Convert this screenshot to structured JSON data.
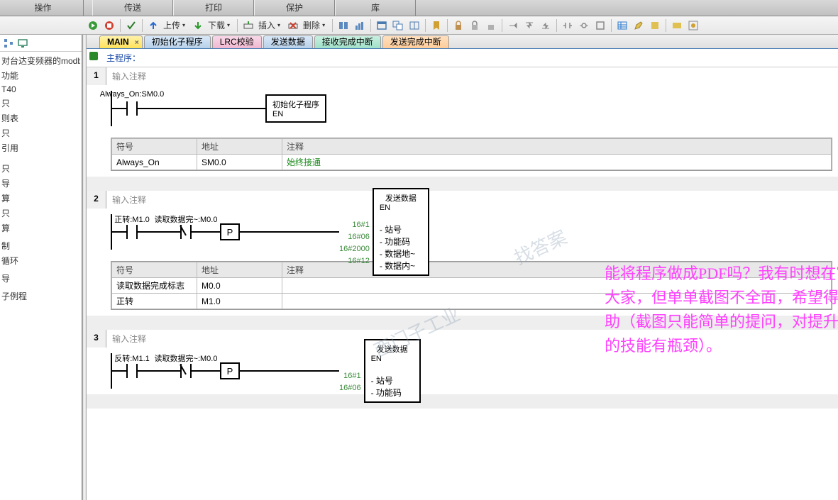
{
  "menu": {
    "items": [
      "操作",
      "传送",
      "打印",
      "保护",
      "库"
    ]
  },
  "toolbar": {
    "upload": "上传",
    "download": "下载",
    "insert": "插入",
    "delete": "删除"
  },
  "sidebar": {
    "items": [
      "对台达变频器的modbu",
      "功能",
      "T40",
      "只",
      "则表",
      "只",
      "引用",
      "",
      "",
      "只",
      "导",
      "算",
      "只",
      "算",
      "",
      "制",
      "循环",
      "",
      "导",
      "",
      "子例程"
    ]
  },
  "tabs": [
    {
      "label": "MAIN",
      "cls": "main close-x"
    },
    {
      "label": "初始化子程序",
      "cls": "blue"
    },
    {
      "label": "LRC校验",
      "cls": "pink"
    },
    {
      "label": "发送数据",
      "cls": "blue"
    },
    {
      "label": "接收完成中断",
      "cls": "teal"
    },
    {
      "label": "发送完成中断",
      "cls": "orange"
    }
  ],
  "prog_title": "主程序：",
  "networks": [
    {
      "num": "1",
      "comment": "输入注释",
      "contacts": [
        {
          "label": "Always_On:SM0.0",
          "type": "no"
        }
      ],
      "box": {
        "title": "初始化子程序",
        "rows": [
          "EN"
        ]
      },
      "symbols": {
        "headers": [
          "符号",
          "地址",
          "注释"
        ],
        "rows": [
          [
            "Always_On",
            "SM0.0",
            "始终接通"
          ]
        ]
      }
    },
    {
      "num": "2",
      "comment": "输入注释",
      "contacts": [
        {
          "label": "正转:M1.0",
          "type": "no"
        },
        {
          "label": "读取数据完~:M0.0",
          "type": "nc"
        }
      ],
      "p": true,
      "box": {
        "title": "发送数据",
        "rows": [
          "EN"
        ],
        "params": [
          {
            "hex": "16#1",
            "name": "站号"
          },
          {
            "hex": "16#06",
            "name": "功能码"
          },
          {
            "hex": "16#2000",
            "name": "数据地~"
          },
          {
            "hex": "16#12",
            "name": "数据内~"
          }
        ]
      },
      "symbols": {
        "headers": [
          "符号",
          "地址",
          "注释"
        ],
        "rows": [
          [
            "读取数据完成标志",
            "M0.0",
            ""
          ],
          [
            "正转",
            "M1.0",
            ""
          ]
        ]
      }
    },
    {
      "num": "3",
      "comment": "输入注释",
      "contacts": [
        {
          "label": "反转:M1.1",
          "type": "no"
        },
        {
          "label": "读取数据完~:M0.0",
          "type": "nc"
        }
      ],
      "p": true,
      "box": {
        "title": "发送数据",
        "rows": [
          "EN"
        ],
        "params": [
          {
            "hex": "16#1",
            "name": "站号"
          },
          {
            "hex": "16#06",
            "name": "功能码"
          }
        ]
      }
    }
  ],
  "annotation": "能将程序做成PDF吗？我有时想在官网请教大家，但单单截图不全面，希望得到大家帮助（截图只能简单的提问，对提升自己更深的技能有瓶颈）。",
  "watermark1": "西门子工业",
  "watermark2": "找答案"
}
